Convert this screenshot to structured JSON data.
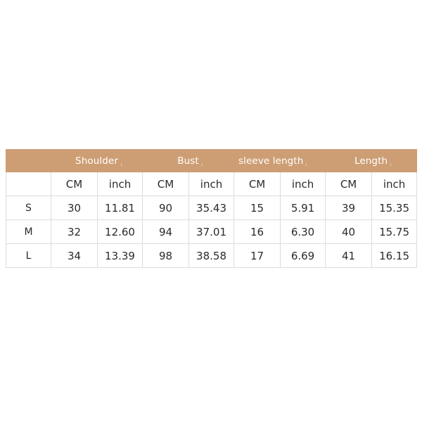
{
  "table": {
    "groups": [
      {
        "label": "",
        "align": "center"
      },
      {
        "label": "Shoulder",
        "align": "center"
      },
      {
        "label": "Bust",
        "align": "center"
      },
      {
        "label": "sleeve length",
        "align": "left"
      },
      {
        "label": "Length",
        "align": "center"
      }
    ],
    "unit_row": [
      "",
      "CM",
      "inch",
      "CM",
      "inch",
      "CM",
      "inch",
      "CM",
      "inch"
    ],
    "rows": [
      {
        "size": "S",
        "shoulder_cm": "30",
        "shoulder_inch": "11.81",
        "bust_cm": "90",
        "bust_inch": "35.43",
        "sleeve_cm": "15",
        "sleeve_inch": "5.91",
        "length_cm": "39",
        "length_inch": "15.35"
      },
      {
        "size": "M",
        "shoulder_cm": "32",
        "shoulder_inch": "12.60",
        "bust_cm": "94",
        "bust_inch": "37.01",
        "sleeve_cm": "16",
        "sleeve_inch": "6.30",
        "length_cm": "40",
        "length_inch": "15.75"
      },
      {
        "size": "L",
        "shoulder_cm": "34",
        "shoulder_inch": "13.39",
        "bust_cm": "98",
        "bust_inch": "38.58",
        "sleeve_cm": "17",
        "sleeve_inch": "6.69",
        "length_cm": "41",
        "length_inch": "16.15"
      }
    ]
  },
  "colors": {
    "header_band": "#cd9e74",
    "header_text": "#ffffff",
    "grid_line": "#dcdcdc",
    "body_text": "#2b2b2b",
    "background": "#ffffff"
  }
}
